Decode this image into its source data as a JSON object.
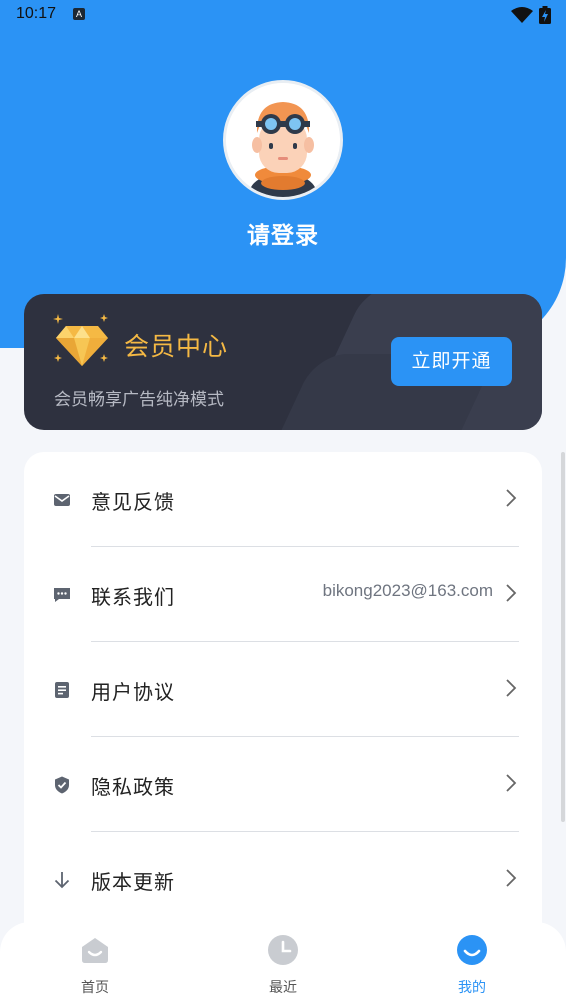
{
  "status_bar": {
    "time": "10:17",
    "notification_icon": "a-badge-icon",
    "wifi_icon": "wifi-icon",
    "battery_icon": "battery-charging-icon"
  },
  "profile": {
    "login_text": "请登录",
    "avatar_icon": "avatar-icon"
  },
  "vip": {
    "title": "会员中心",
    "subtitle": "会员畅享广告纯净模式",
    "button": "立即开通",
    "icon": "diamond-icon",
    "title_color": "#f5b944"
  },
  "menu": {
    "items": [
      {
        "label": "意见反馈",
        "value": "",
        "icon": "mail-icon"
      },
      {
        "label": "联系我们",
        "value": "bikong2023@163.com",
        "icon": "chat-icon"
      },
      {
        "label": "用户协议",
        "value": "",
        "icon": "document-icon"
      },
      {
        "label": "隐私政策",
        "value": "",
        "icon": "shield-icon"
      },
      {
        "label": "版本更新",
        "value": "",
        "icon": "arrow-down-icon"
      }
    ]
  },
  "bottom_nav": {
    "items": [
      {
        "label": "首页",
        "icon": "home-icon",
        "active": false
      },
      {
        "label": "最近",
        "icon": "clock-icon",
        "active": false
      },
      {
        "label": "我的",
        "icon": "profile-smile-icon",
        "active": true
      }
    ]
  },
  "colors": {
    "primary": "#2b93f5",
    "vip_card": "#2e313f"
  }
}
